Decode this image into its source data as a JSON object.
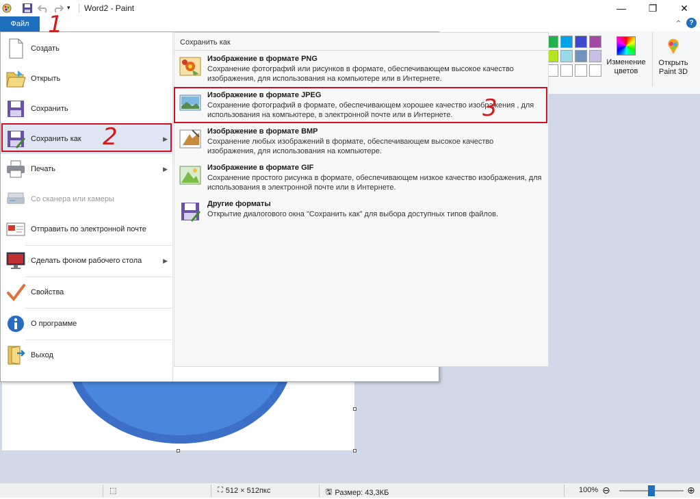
{
  "window": {
    "title": "Word2 - Paint",
    "minimize": "—",
    "maximize": "❐",
    "close": "✕"
  },
  "quick_access": {
    "icons": [
      "paint-app-icon",
      "save-icon",
      "undo-icon",
      "redo-icon",
      "customize-dropdown-icon"
    ]
  },
  "ribbon": {
    "file_tab": "Файл",
    "edit_colors": "Изменение\nцветов",
    "open_paint3d": "Открыть\nPaint 3D",
    "palette_colors": [
      "#22b14c",
      "#00a2e8",
      "#3f48cc",
      "#a349a4",
      "#b5e61d",
      "#99d9ea",
      "#7092be",
      "#c8bfe7",
      "#ffffff",
      "#ffffff",
      "#ffffff",
      "#ffffff"
    ],
    "help_icon": "help-icon",
    "collapse_icon": "chevron-up-icon"
  },
  "file_menu": {
    "items": [
      {
        "label": "Создать",
        "icon": "new-document-icon",
        "arrow": false,
        "disabled": false
      },
      {
        "label": "Открыть",
        "icon": "open-folder-icon",
        "arrow": false,
        "disabled": false
      },
      {
        "label": "Сохранить",
        "icon": "save-icon",
        "arrow": false,
        "disabled": false
      },
      {
        "label": "Сохранить как",
        "icon": "save-as-icon",
        "arrow": true,
        "disabled": false
      },
      {
        "label": "Печать",
        "icon": "printer-icon",
        "arrow": true,
        "disabled": false
      },
      {
        "label": "Со сканера или камеры",
        "icon": "scanner-icon",
        "arrow": false,
        "disabled": true
      },
      {
        "label": "Отправить по электронной почте",
        "icon": "email-icon",
        "arrow": false,
        "disabled": false
      },
      {
        "label": "Сделать фоном рабочего стола",
        "icon": "desktop-background-icon",
        "arrow": true,
        "disabled": false
      },
      {
        "label": "Свойства",
        "icon": "checkmark-icon",
        "arrow": false,
        "disabled": false
      },
      {
        "label": "О программе",
        "icon": "info-icon",
        "arrow": false,
        "disabled": false
      },
      {
        "label": "Выход",
        "icon": "exit-icon",
        "arrow": false,
        "disabled": false
      }
    ]
  },
  "save_as_panel": {
    "heading": "Сохранить как",
    "formats": [
      {
        "title": "Изображение в формате PNG",
        "description": "Сохранение фотографий или рисунков в формате, обеспечивающем высокое качество изображения, для использования на компьютере или в Интернете.",
        "icon": "png-format-icon"
      },
      {
        "title": "Изображение в формате JPEG",
        "description": "Сохранение фотографий в формате, обеспечивающем хорошее качество изображения , для использования на компьютере, в электронной почте или в Интернете.",
        "icon": "jpeg-format-icon"
      },
      {
        "title": "Изображение в формате BMP",
        "description": "Сохранение любых изображений в формате, обеспечивающем высокое качество изображения, для использования на компьютере.",
        "icon": "bmp-format-icon"
      },
      {
        "title": "Изображение в формате GIF",
        "description": "Сохранение простого рисунка в формате, обеспечивающем низкое качество изображения, для использования в электронной почте или в Интернете.",
        "icon": "gif-format-icon"
      },
      {
        "title": "Другие форматы",
        "description": "Открытие диалогового окна \"Сохранить как\" для выбора доступных типов файлов.",
        "icon": "other-formats-icon"
      }
    ]
  },
  "annotations": {
    "step1": "1",
    "step2": "2",
    "step3": "3",
    "color": "#d51a1a"
  },
  "statusbar": {
    "dimensions": "512 × 512пкс",
    "size": "Размер: 43,3КБ",
    "zoom": "100%",
    "zoom_level": 0.5,
    "zoom_out": "⊖",
    "zoom_in": "⊕"
  }
}
